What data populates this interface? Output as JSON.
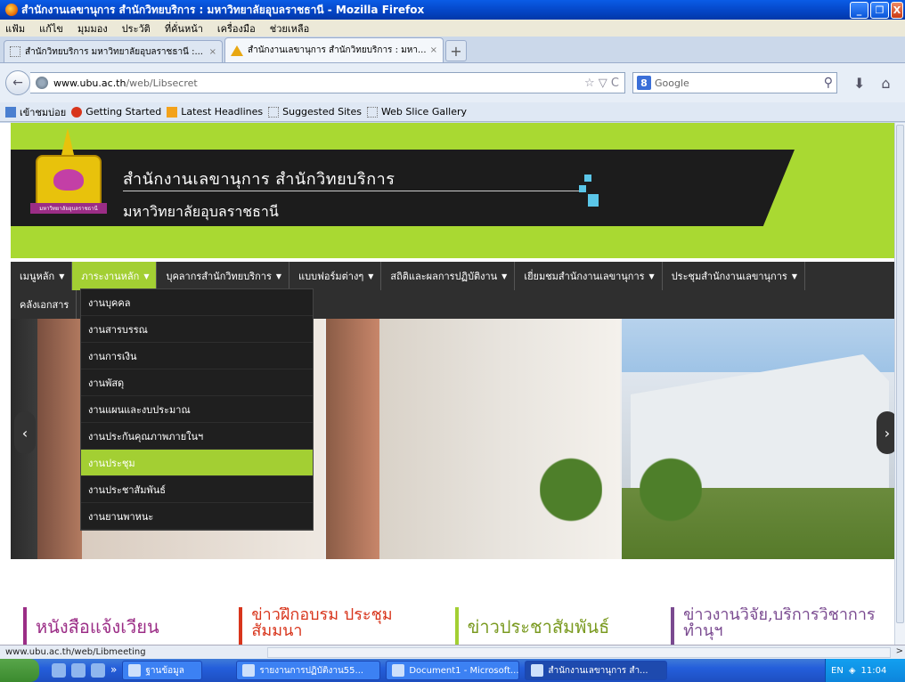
{
  "window": {
    "title": "สำนักงานเลขานุการ สำนักวิทยบริการ : มหาวิทยาลัยอุบลราชธานี - Mozilla Firefox",
    "buttons": {
      "minimize": "_",
      "maximize": "❐",
      "close": "X"
    }
  },
  "menu": [
    "แฟ้ม",
    "แก้ไข",
    "มุมมอง",
    "ประวัติ",
    "ที่คั่นหน้า",
    "เครื่องมือ",
    "ช่วยเหลือ"
  ],
  "tabs": [
    {
      "label": "สำนักวิทยบริการ มหาวิทยาลัยอุบลราชธานี :...",
      "close": "×"
    },
    {
      "label": "สำนักงานเลขานุการ สำนักวิทยบริการ : มหา...",
      "close": "×"
    }
  ],
  "newtab": "+",
  "nav": {
    "back": "←",
    "url_host": "www.ubu.ac.th",
    "url_path": "/web/Libsecret",
    "url_icons": "☆ ▽ C",
    "search_engine_letter": "8",
    "search_placeholder": "Google",
    "search_icon": "⚲",
    "download_icon": "⬇",
    "home_icon": "⌂"
  },
  "bookmarks": [
    "เข้าชมบ่อย",
    "Getting Started",
    "Latest Headlines",
    "Suggested Sites",
    "Web Slice Gallery"
  ],
  "site": {
    "title": "สำนักงานเลขานุการ สำนักวิทยบริการ",
    "subtitle": "มหาวิทยาลัยอุบลราชธานี",
    "logo_ribbon": "มหาวิทยาลัยอุบลราชธานี",
    "accent": "#a3cf33",
    "nav_row1": [
      "เมนูหลัก",
      "ภาระงานหลัก",
      "บุคลากรสำนักวิทยบริการ",
      "แบบฟอร์มต่างๆ",
      "สถิติและผลการปฏิบัติงาน",
      "เยี่ยมชมสำนักงานเลขานุการ",
      "ประชุมสำนักงานเลขานุการ"
    ],
    "nav_row2": [
      "คลังเอกสาร"
    ],
    "caret": "▼",
    "dropdown": [
      "งานบุคคล",
      "งานสารบรรณ",
      "งานการเงิน",
      "งานพัสดุ",
      "งานแผนและงบประมาณ",
      "งานประกันคุณภาพภายในฯ",
      "งานประชุม",
      "งานประชาสัมพันธ์",
      "งานยานพาหนะ"
    ],
    "slider_prev": "‹",
    "slider_next": "›",
    "sections": [
      "หนังสือแจ้งเวียน",
      "ข่าวฝึกอบรม ประชุม สัมมนา",
      "ข่าวประชาสัมพันธ์",
      "ข่าวงานวิจัย,บริการวิชาการ ทำนุฯ"
    ]
  },
  "status": {
    "text": "www.ubu.ac.th/web/Libmeeting",
    "right_arrow": ">"
  },
  "taskbar": {
    "quick_more": "»",
    "tasks": [
      "ฐานข้อมูล",
      "รายงานการปฏิบัติงาน55...",
      "Document1 - Microsoft...",
      "สำนักงานเลขานุการ สำ..."
    ],
    "lang": "EN",
    "clock": "11:04"
  }
}
